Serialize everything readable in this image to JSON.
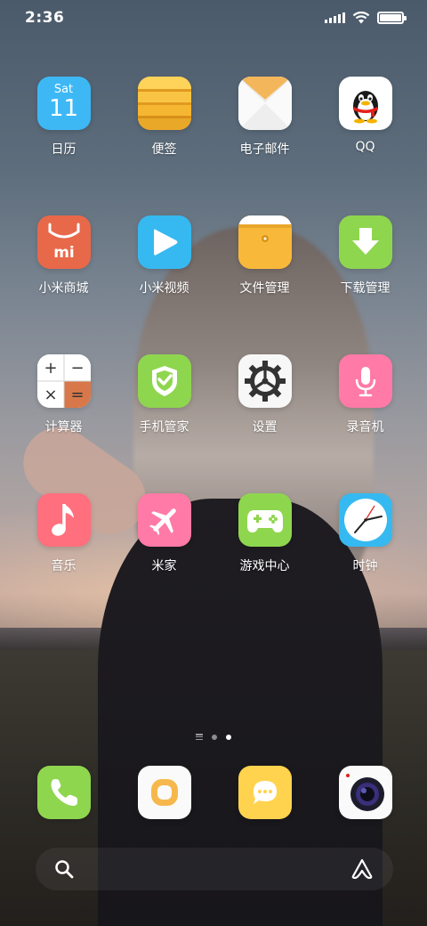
{
  "status_bar": {
    "time": "2:36",
    "signal_bars": 4,
    "battery_level": 1.0
  },
  "apps": [
    {
      "label": "日历",
      "icon": "calendar-icon",
      "day": "Sat",
      "date": "11"
    },
    {
      "label": "便签",
      "icon": "notes-icon"
    },
    {
      "label": "电子邮件",
      "icon": "email-icon"
    },
    {
      "label": "QQ",
      "icon": "qq-penguin-icon"
    },
    {
      "label": "小米商城",
      "icon": "mi-store-icon",
      "mi": "mi"
    },
    {
      "label": "小米视频",
      "icon": "video-play-icon"
    },
    {
      "label": "文件管理",
      "icon": "folder-icon"
    },
    {
      "label": "下载管理",
      "icon": "download-arrow-icon"
    },
    {
      "label": "计算器",
      "icon": "calculator-icon",
      "symbols": [
        "+",
        "−",
        "×",
        "="
      ]
    },
    {
      "label": "手机管家",
      "icon": "shield-check-icon"
    },
    {
      "label": "设置",
      "icon": "gear-icon"
    },
    {
      "label": "录音机",
      "icon": "microphone-icon"
    },
    {
      "label": "音乐",
      "icon": "music-note-icon"
    },
    {
      "label": "米家",
      "icon": "airplane-icon"
    },
    {
      "label": "游戏中心",
      "icon": "gamepad-icon"
    },
    {
      "label": "时钟",
      "icon": "clock-icon"
    }
  ],
  "dock": [
    {
      "icon": "phone-icon"
    },
    {
      "icon": "browser-ring-icon"
    },
    {
      "icon": "messages-icon"
    },
    {
      "icon": "camera-lens-icon"
    }
  ],
  "pages": {
    "count": 2,
    "active": 2
  },
  "colors": {
    "calendar": "#3db8f5",
    "notes": "#f5b731",
    "mi_store": "#e8684a",
    "video": "#36b9f0",
    "files": "#f8b93b",
    "download": "#8fd64f",
    "shield": "#8fd64f",
    "recorder": "#ff7aa6",
    "music": "#ff6f7d",
    "mijia": "#ff7aa6",
    "game": "#8fd64f",
    "clock": "#36b9f0",
    "phone": "#8fd64f",
    "messages": "#ffd34e"
  }
}
